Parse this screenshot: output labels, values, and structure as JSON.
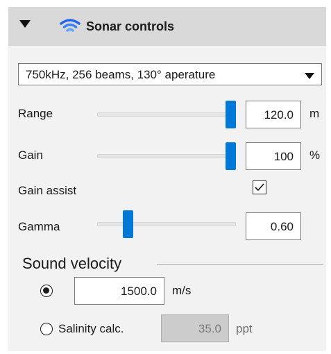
{
  "header": {
    "title": "Sonar controls",
    "collapse_icon": "caret-down-icon",
    "icon": "wifi-signal-icon",
    "icon_color": "#1e64f0"
  },
  "preset": {
    "selected": "750kHz, 256 beams, 130° aperature",
    "arrow_icon": "caret-down-icon"
  },
  "range": {
    "label": "Range",
    "value": "120.0",
    "unit": "m",
    "slider_fraction": 1.0
  },
  "gain": {
    "label": "Gain",
    "value": "100",
    "unit": "%",
    "slider_fraction": 1.0
  },
  "gain_assist": {
    "label": "Gain assist",
    "checked": true,
    "check_icon": "checkmark-icon"
  },
  "gamma": {
    "label": "Gamma",
    "value": "0.60",
    "slider_fraction": 0.2
  },
  "sound_velocity": {
    "title": "Sound velocity",
    "manual": {
      "selected": true,
      "value": "1500.0",
      "unit": "m/s"
    },
    "salinity": {
      "selected": false,
      "label": "Salinity calc.",
      "value": "35.0",
      "unit": "ppt",
      "disabled": true
    }
  },
  "colors": {
    "accent": "#0078d7",
    "header_bg": "#d9d9d9",
    "panel_bg": "#f2f2f2"
  }
}
